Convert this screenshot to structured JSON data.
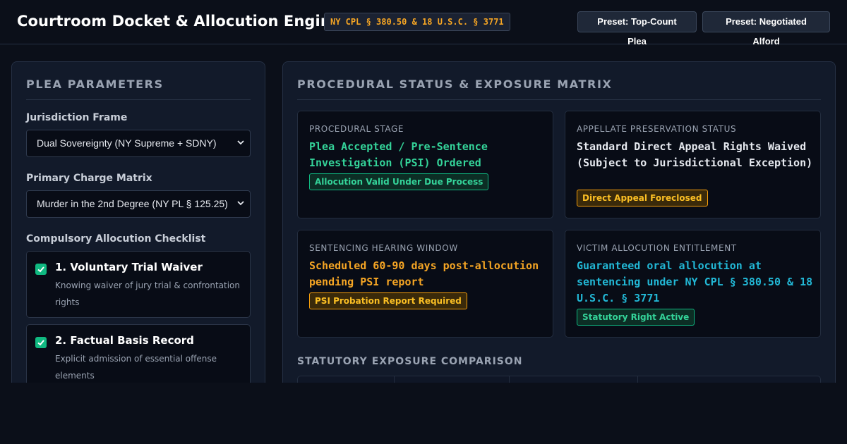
{
  "header": {
    "title": "Courtroom Docket & Allocution Engine",
    "statute_badge": "NY CPL § 380.50 & 18 U.S.C. § 3771",
    "presets": [
      {
        "label": "Preset: Top-Count Plea"
      },
      {
        "label": "Preset: Negotiated Alford"
      }
    ]
  },
  "plea_parameters": {
    "title": "PLEA PARAMETERS",
    "jurisdiction": {
      "label": "Jurisdiction Frame",
      "value": "Dual Sovereignty (NY Supreme + SDNY)"
    },
    "charge": {
      "label": "Primary Charge Matrix",
      "value": "Murder in the 2nd Degree (NY PL § 125.25)"
    },
    "checklist": {
      "label": "Compulsory Allocution Checklist",
      "items": [
        {
          "title": "1. Voluntary Trial Waiver",
          "description": "Knowing waiver of jury trial & confrontation rights",
          "checked": true
        },
        {
          "title": "2. Factual Basis Record",
          "description": "Explicit admission of essential offense elements",
          "checked": true
        }
      ]
    }
  },
  "status_matrix": {
    "title": "PROCEDURAL STATUS & EXPOSURE MATRIX",
    "cards": [
      {
        "label": "PROCEDURAL STAGE",
        "value": "Plea Accepted / Pre-Sentence Investigation (PSI) Ordered",
        "value_color": "#34d399",
        "badge": "Allocution Valid Under Due Process",
        "badge_tone": "green"
      },
      {
        "label": "APPELLATE PRESERVATION STATUS",
        "value": "Standard Direct Appeal Rights Waived (Subject to Jurisdictional Exception)",
        "value_color": "#e6e9ef",
        "badge": "Direct Appeal Foreclosed",
        "badge_tone": "amber"
      },
      {
        "label": "SENTENCING HEARING WINDOW",
        "value": "Scheduled 60-90 days post-allocution pending PSI report",
        "value_color": "#f5a524",
        "badge": "PSI Probation Report Required",
        "badge_tone": "amber"
      },
      {
        "label": "VICTIM ALLOCUTION ENTITLEMENT",
        "value": "Guaranteed oral allocution at sentencing under NY CPL § 380.50 & 18 U.S.C. § 3771",
        "value_color": "#22b8d6",
        "badge": "Statutory Right Active",
        "badge_tone": "green"
      }
    ],
    "exposure_title": "STATUTORY EXPOSURE COMPARISON"
  }
}
